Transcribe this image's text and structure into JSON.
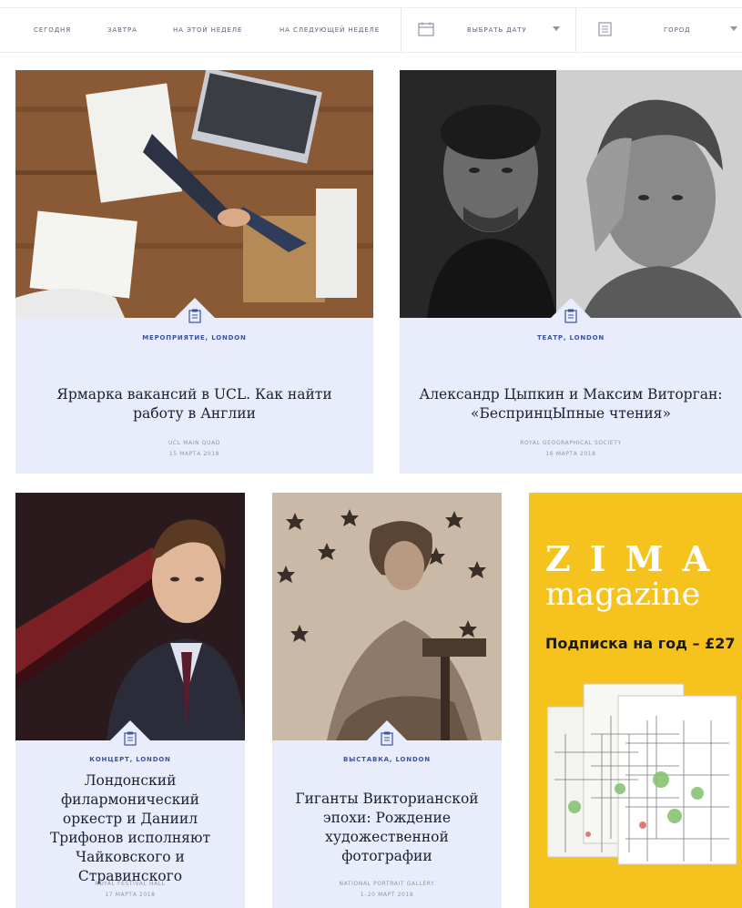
{
  "filters": {
    "today": "Сегодня",
    "tomorrow": "Завтра",
    "this_week": "На этой неделе",
    "next_week": "На следующей неделе",
    "pick_date": "Выбрать дату",
    "city": "Город"
  },
  "icons": {
    "calendar": "calendar-icon",
    "city": "newspaper-icon",
    "event": "event-list-icon",
    "dropdown": "chevron-down-icon"
  },
  "colors": {
    "card_bg": "#e9edfb",
    "accent": "#3b52a3",
    "ad_bg": "#f6c21d"
  },
  "cards": [
    {
      "category": "Мероприятие, London",
      "title": "Ярмарка вакансий в UCL. Как найти работу в Англии",
      "venue": "UCL Main Quad",
      "date": "15 марта 2018"
    },
    {
      "category": "Театр, London",
      "title": "Александр Цыпкин и Максим Виторган: «БеспринцЫпные чтения»",
      "venue": "Royal Geographical Society",
      "date": "16 марта 2018"
    },
    {
      "category": "Концерт, London",
      "title": "Лондонский филармонический оркестр и Даниил Трифонов исполняют Чайковского и Стравинского",
      "venue": "Royal Festival Hall",
      "date": "17 марта 2018"
    },
    {
      "category": "Выставка, London",
      "title": "Гиганты Викторианской эпохи: Рождение художественной фотографии",
      "venue": "National Portrait Gallery",
      "date": "1–20 март 2018"
    }
  ],
  "ad": {
    "brand": "ZIMA",
    "brand_sub": "magazine",
    "offer": "Подписка на год – £27"
  }
}
